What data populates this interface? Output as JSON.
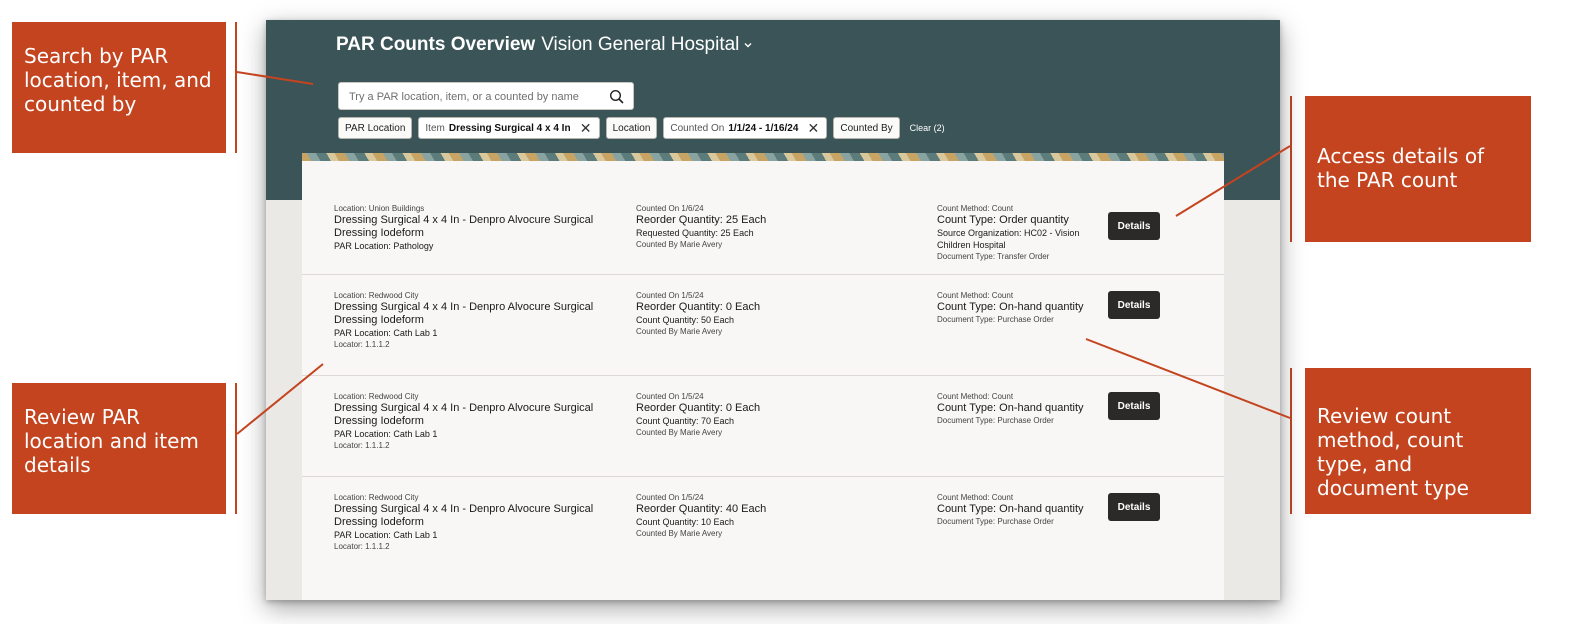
{
  "callouts": {
    "search": "Search by PAR location, item, and counted by",
    "details": "Access details of the PAR count",
    "review_location": "Review PAR location and item details",
    "review_count": "Review count method, count type, and document type"
  },
  "header": {
    "title": "PAR Counts Overview",
    "org": "Vision General Hospital"
  },
  "search": {
    "placeholder": "Try a PAR location, item, or a counted by name"
  },
  "filters": {
    "par_location": "PAR Location",
    "item_label": "Item",
    "item_value": "Dressing Surgical 4 x 4 In",
    "location": "Location",
    "counted_on_label": "Counted On",
    "counted_on_value": "1/1/24 - 1/16/24",
    "counted_by": "Counted By",
    "clear": "Clear (2)"
  },
  "details_label": "Details",
  "rows": [
    {
      "location": "Location: Union Buildings",
      "item": "Dressing Surgical 4 x 4 In - Denpro Alvocure Surgical Dressing Iodeform",
      "par_location": "PAR Location: Pathology",
      "locator": "",
      "counted_on": "Counted On 1/6/24",
      "reorder": "Reorder Quantity: 25 Each",
      "qty": "Requested Quantity: 25 Each",
      "counted_by": "Counted By Marie Avery",
      "method": "Count Method: Count",
      "type": "Count Type: Order quantity",
      "source": "Source Organization: HC02 - Vision Children Hospital",
      "doc_type": "Document Type: Transfer Order"
    },
    {
      "location": "Location: Redwood City",
      "item": "Dressing Surgical 4 x 4 In - Denpro Alvocure Surgical Dressing Iodeform",
      "par_location": "PAR Location: Cath Lab 1",
      "locator": "Locator: 1.1.1.2",
      "counted_on": "Counted On 1/5/24",
      "reorder": "Reorder Quantity: 0 Each",
      "qty": "Count Quantity: 50 Each",
      "counted_by": "Counted By Marie Avery",
      "method": "Count Method: Count",
      "type": "Count Type: On-hand quantity",
      "source": "",
      "doc_type": "Document Type: Purchase Order"
    },
    {
      "location": "Location: Redwood City",
      "item": "Dressing Surgical 4 x 4 In - Denpro Alvocure Surgical Dressing Iodeform",
      "par_location": "PAR Location: Cath Lab 1",
      "locator": "Locator: 1.1.1.2",
      "counted_on": "Counted On 1/5/24",
      "reorder": "Reorder Quantity: 0 Each",
      "qty": "Count Quantity: 70 Each",
      "counted_by": "Counted By Marie Avery",
      "method": "Count Method: Count",
      "type": "Count Type: On-hand quantity",
      "source": "",
      "doc_type": "Document Type: Purchase Order"
    },
    {
      "location": "Location: Redwood City",
      "item": "Dressing Surgical 4 x 4 In - Denpro Alvocure Surgical Dressing Iodeform",
      "par_location": "PAR Location: Cath Lab 1",
      "locator": "Locator: 1.1.1.2",
      "counted_on": "Counted On 1/5/24",
      "reorder": "Reorder Quantity: 40 Each",
      "qty": "Count Quantity: 10 Each",
      "counted_by": "Counted By Marie Avery",
      "method": "Count Method: Count",
      "type": "Count Type: On-hand quantity",
      "source": "",
      "doc_type": "Document Type: Purchase Order"
    }
  ],
  "colors": {
    "callout": "#c3441f",
    "header": "#3b5457",
    "button": "#2b2a28"
  }
}
